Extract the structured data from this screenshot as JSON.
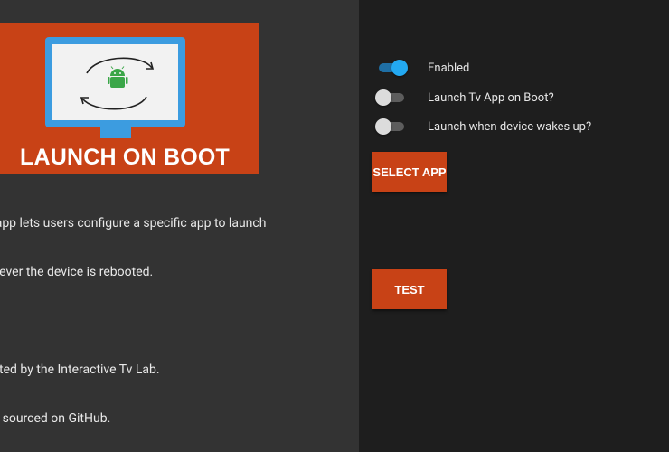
{
  "banner": {
    "title": "LAUNCH ON BOOT",
    "colors": {
      "banner": "#c84216",
      "tv_frame": "#3c9ce0",
      "android_logo": "#3aa648"
    },
    "icons": [
      "tv-icon",
      "android-robot-icon",
      "refresh-arrows-icon"
    ]
  },
  "description": {
    "lines": [
      "s app lets users configure a specific app to launch",
      "enever the device is rebooted.",
      "",
      "eated by the Interactive Tv Lab.",
      "en sourced on GitHub."
    ]
  },
  "settings": [
    {
      "label": "Enabled",
      "checked": true
    },
    {
      "label": "Launch Tv App on Boot?",
      "checked": false
    },
    {
      "label": "Launch when device wakes up?",
      "checked": false
    }
  ],
  "buttons": {
    "select_app": "SELECT APP",
    "test": "TEST"
  },
  "theme": {
    "accent": "#c84216",
    "switch_on": "#23a9f2"
  }
}
